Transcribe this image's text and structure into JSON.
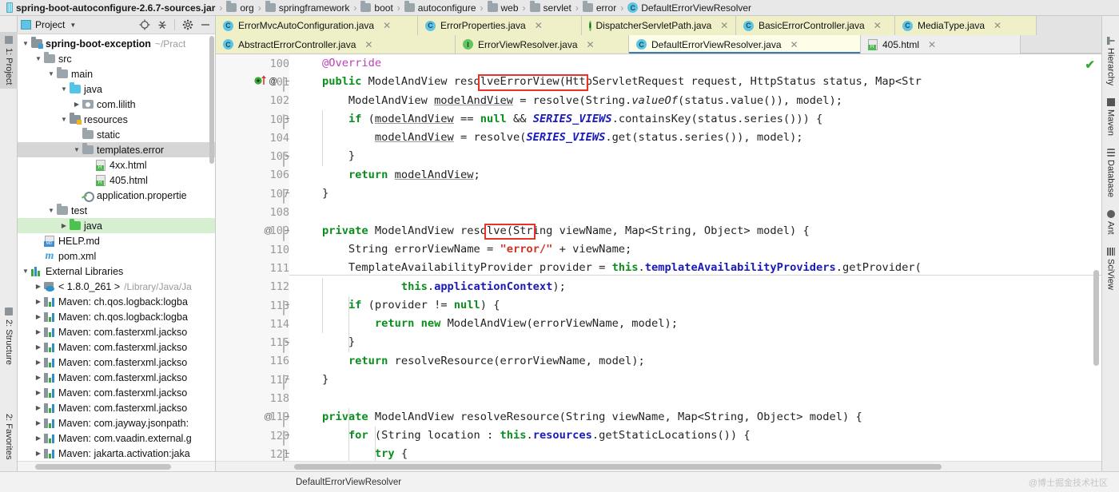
{
  "breadcrumb": [
    {
      "icon": "jar-icon",
      "label": "spring-boot-autoconfigure-2.6.7-sources.jar",
      "type": "jar"
    },
    {
      "icon": "folder-icon",
      "label": "org",
      "type": "folder"
    },
    {
      "icon": "folder-icon",
      "label": "springframework",
      "type": "folder"
    },
    {
      "icon": "folder-icon",
      "label": "boot",
      "type": "folder"
    },
    {
      "icon": "folder-icon",
      "label": "autoconfigure",
      "type": "folder"
    },
    {
      "icon": "folder-icon",
      "label": "web",
      "type": "folder"
    },
    {
      "icon": "folder-icon",
      "label": "servlet",
      "type": "folder"
    },
    {
      "icon": "folder-icon",
      "label": "error",
      "type": "folder"
    },
    {
      "icon": "class-icon",
      "label": "DefaultErrorViewResolver",
      "type": "class"
    }
  ],
  "left_strip": {
    "tabs": [
      {
        "label": "1: Project",
        "selected": true
      },
      {
        "label": "2: Structure",
        "selected": false
      },
      {
        "label": "2: Favorites",
        "selected": false
      }
    ]
  },
  "project_panel": {
    "title": "Project",
    "toolbar_icons": [
      "locate-icon",
      "collapse-all-icon",
      "gear-icon",
      "minimize-icon"
    ],
    "tree": [
      {
        "indent": 0,
        "arrow": "open",
        "icon": "module-folder-icon",
        "label": "spring-boot-exception",
        "bold": true,
        "sub": "~/Pract",
        "state": "normal"
      },
      {
        "indent": 1,
        "arrow": "open",
        "icon": "folder-gray-icon",
        "label": "src",
        "bold": false,
        "sub": "",
        "state": "normal"
      },
      {
        "indent": 2,
        "arrow": "open",
        "icon": "folder-gray-icon",
        "label": "main",
        "bold": false,
        "sub": "",
        "state": "normal"
      },
      {
        "indent": 3,
        "arrow": "open",
        "icon": "folder-blue-icon",
        "label": "java",
        "bold": false,
        "sub": "",
        "state": "normal"
      },
      {
        "indent": 4,
        "arrow": "closed",
        "icon": "package-icon",
        "label": "com.lilith",
        "bold": false,
        "sub": "",
        "state": "normal"
      },
      {
        "indent": 3,
        "arrow": "open",
        "icon": "resources-folder-icon",
        "label": "resources",
        "bold": false,
        "sub": "",
        "state": "normal"
      },
      {
        "indent": 4,
        "arrow": "none",
        "icon": "folder-gray-icon",
        "label": "static",
        "bold": false,
        "sub": "",
        "state": "normal"
      },
      {
        "indent": 4,
        "arrow": "open",
        "icon": "folder-gray-icon",
        "label": "templates.error",
        "bold": false,
        "sub": "",
        "state": "selected"
      },
      {
        "indent": 5,
        "arrow": "none",
        "icon": "html-file-icon",
        "label": "4xx.html",
        "bold": false,
        "sub": "",
        "state": "normal"
      },
      {
        "indent": 5,
        "arrow": "none",
        "icon": "html-file-icon",
        "label": "405.html",
        "bold": false,
        "sub": "",
        "state": "normal"
      },
      {
        "indent": 4,
        "arrow": "none",
        "icon": "properties-file-icon",
        "label": "application.propertie",
        "bold": false,
        "sub": "",
        "state": "normal"
      },
      {
        "indent": 2,
        "arrow": "open",
        "icon": "folder-gray-icon",
        "label": "test",
        "bold": false,
        "sub": "",
        "state": "normal"
      },
      {
        "indent": 3,
        "arrow": "closed",
        "icon": "folder-green-icon",
        "label": "java",
        "bold": false,
        "sub": "",
        "state": "greensel"
      },
      {
        "indent": 1,
        "arrow": "none",
        "icon": "markdown-file-icon",
        "label": "HELP.md",
        "bold": false,
        "sub": "",
        "state": "normal"
      },
      {
        "indent": 1,
        "arrow": "none",
        "icon": "maven-xml-icon",
        "label": "pom.xml",
        "bold": false,
        "sub": "",
        "state": "normal"
      },
      {
        "indent": 0,
        "arrow": "open",
        "icon": "external-libraries-icon",
        "label": "External Libraries",
        "bold": false,
        "sub": "",
        "state": "normal"
      },
      {
        "indent": 1,
        "arrow": "closed",
        "icon": "jdk-icon",
        "label": "< 1.8.0_261 >",
        "bold": false,
        "sub": "/Library/Java/Ja",
        "state": "normal"
      },
      {
        "indent": 1,
        "arrow": "closed",
        "icon": "maven-lib-icon",
        "label": "Maven: ch.qos.logback:logba",
        "bold": false,
        "sub": "",
        "state": "normal"
      },
      {
        "indent": 1,
        "arrow": "closed",
        "icon": "maven-lib-icon",
        "label": "Maven: ch.qos.logback:logba",
        "bold": false,
        "sub": "",
        "state": "normal"
      },
      {
        "indent": 1,
        "arrow": "closed",
        "icon": "maven-lib-icon",
        "label": "Maven: com.fasterxml.jackso",
        "bold": false,
        "sub": "",
        "state": "normal"
      },
      {
        "indent": 1,
        "arrow": "closed",
        "icon": "maven-lib-icon",
        "label": "Maven: com.fasterxml.jackso",
        "bold": false,
        "sub": "",
        "state": "normal"
      },
      {
        "indent": 1,
        "arrow": "closed",
        "icon": "maven-lib-icon",
        "label": "Maven: com.fasterxml.jackso",
        "bold": false,
        "sub": "",
        "state": "normal"
      },
      {
        "indent": 1,
        "arrow": "closed",
        "icon": "maven-lib-icon",
        "label": "Maven: com.fasterxml.jackso",
        "bold": false,
        "sub": "",
        "state": "normal"
      },
      {
        "indent": 1,
        "arrow": "closed",
        "icon": "maven-lib-icon",
        "label": "Maven: com.fasterxml.jackso",
        "bold": false,
        "sub": "",
        "state": "normal"
      },
      {
        "indent": 1,
        "arrow": "closed",
        "icon": "maven-lib-icon",
        "label": "Maven: com.fasterxml.jackso",
        "bold": false,
        "sub": "",
        "state": "normal"
      },
      {
        "indent": 1,
        "arrow": "closed",
        "icon": "maven-lib-icon",
        "label": "Maven: com.jayway.jsonpath:",
        "bold": false,
        "sub": "",
        "state": "normal"
      },
      {
        "indent": 1,
        "arrow": "closed",
        "icon": "maven-lib-icon",
        "label": "Maven: com.vaadin.external.g",
        "bold": false,
        "sub": "",
        "state": "normal"
      },
      {
        "indent": 1,
        "arrow": "closed",
        "icon": "maven-lib-icon",
        "label": "Maven: jakarta.activation:jaka",
        "bold": false,
        "sub": "",
        "state": "normal"
      }
    ]
  },
  "editor_tabs_row1": [
    {
      "label": "ErrorMvcAutoConfiguration.java",
      "icon": "class-icon",
      "closable": true,
      "active": false
    },
    {
      "label": "ErrorProperties.java",
      "icon": "class-icon",
      "closable": true,
      "active": false
    },
    {
      "label": "DispatcherServletPath.java",
      "icon": "interface-icon",
      "closable": true,
      "active": false
    },
    {
      "label": "BasicErrorController.java",
      "icon": "class-icon",
      "closable": true,
      "active": false
    },
    {
      "label": "MediaType.java",
      "icon": "class-icon",
      "closable": true,
      "active": false
    }
  ],
  "editor_tabs_row2": [
    {
      "label": "AbstractErrorController.java",
      "icon": "class-icon",
      "closable": true,
      "active": false
    },
    {
      "label": "ErrorViewResolver.java",
      "icon": "interface-icon",
      "closable": true,
      "active": false
    },
    {
      "label": "DefaultErrorViewResolver.java",
      "icon": "class-icon",
      "closable": true,
      "active": true
    },
    {
      "label": "405.html",
      "icon": "html-file-icon",
      "closable": true,
      "active": false
    }
  ],
  "editor": {
    "inspection_ok_icon": "green-check-icon",
    "lines": [
      {
        "num": "100",
        "gutter": "",
        "fold": false,
        "tokens": [
          {
            "t": "    ",
            "c": ""
          },
          {
            "t": "@Override",
            "c": "ann"
          }
        ]
      },
      {
        "num": "101",
        "gutter": "impl-override-icon",
        "fold": true,
        "tokens": [
          {
            "t": "    ",
            "c": ""
          },
          {
            "t": "public",
            "c": "kw"
          },
          {
            "t": " ModelAndView resolveErrorView(HttpServletRequest request, HttpStatus status, Map<Str",
            "c": ""
          }
        ]
      },
      {
        "num": "102",
        "gutter": "",
        "fold": false,
        "tokens": [
          {
            "t": "        ModelAndView ",
            "c": ""
          },
          {
            "t": "modelAndView",
            "c": "und"
          },
          {
            "t": " = resolve(String.",
            "c": ""
          },
          {
            "t": "valueOf",
            "c": "it"
          },
          {
            "t": "(status.value()), model);",
            "c": ""
          }
        ]
      },
      {
        "num": "103",
        "gutter": "",
        "fold": true,
        "tokens": [
          {
            "t": "        ",
            "c": ""
          },
          {
            "t": "if",
            "c": "kw"
          },
          {
            "t": " (",
            "c": ""
          },
          {
            "t": "modelAndView",
            "c": "und"
          },
          {
            "t": " == ",
            "c": ""
          },
          {
            "t": "null",
            "c": "kw"
          },
          {
            "t": " && ",
            "c": ""
          },
          {
            "t": "SERIES_VIEWS",
            "c": "cst"
          },
          {
            "t": ".containsKey(status.series())) {",
            "c": ""
          }
        ]
      },
      {
        "num": "104",
        "gutter": "",
        "fold": false,
        "tokens": [
          {
            "t": "            ",
            "c": ""
          },
          {
            "t": "modelAndView",
            "c": "und"
          },
          {
            "t": " = resolve(",
            "c": ""
          },
          {
            "t": "SERIES_VIEWS",
            "c": "cst"
          },
          {
            "t": ".get(status.series()), model);",
            "c": ""
          }
        ]
      },
      {
        "num": "105",
        "gutter": "",
        "fold": true,
        "tokens": [
          {
            "t": "        }",
            "c": ""
          }
        ]
      },
      {
        "num": "106",
        "gutter": "",
        "fold": false,
        "tokens": [
          {
            "t": "        ",
            "c": ""
          },
          {
            "t": "return",
            "c": "kw"
          },
          {
            "t": " ",
            "c": ""
          },
          {
            "t": "modelAndView",
            "c": "und"
          },
          {
            "t": ";",
            "c": ""
          }
        ]
      },
      {
        "num": "107",
        "gutter": "",
        "fold": true,
        "tokens": [
          {
            "t": "    }",
            "c": ""
          }
        ]
      },
      {
        "num": "108",
        "gutter": "",
        "fold": false,
        "tokens": [
          {
            "t": "",
            "c": ""
          }
        ]
      },
      {
        "num": "109",
        "gutter": "@",
        "fold": true,
        "tokens": [
          {
            "t": "    ",
            "c": ""
          },
          {
            "t": "private",
            "c": "kw"
          },
          {
            "t": " ModelAndView resolve(String viewName, Map<String, Object> model) {",
            "c": ""
          }
        ]
      },
      {
        "num": "110",
        "gutter": "",
        "fold": false,
        "tokens": [
          {
            "t": "        String errorViewName = ",
            "c": ""
          },
          {
            "t": "\"error/\"",
            "c": "str"
          },
          {
            "t": " + viewName;",
            "c": ""
          }
        ]
      },
      {
        "num": "111",
        "gutter": "",
        "fold": false,
        "tokens": [
          {
            "t": "        TemplateAvailabilityProvider provider = ",
            "c": ""
          },
          {
            "t": "this",
            "c": "kw"
          },
          {
            "t": ".",
            "c": ""
          },
          {
            "t": "templateAvailabilityProviders",
            "c": "fld"
          },
          {
            "t": ".getProvider(",
            "c": ""
          }
        ]
      },
      {
        "num": "112",
        "gutter": "",
        "fold": false,
        "tokens": [
          {
            "t": "                ",
            "c": ""
          },
          {
            "t": "this",
            "c": "kw"
          },
          {
            "t": ".",
            "c": ""
          },
          {
            "t": "applicationContext",
            "c": "fld"
          },
          {
            "t": ");",
            "c": ""
          }
        ]
      },
      {
        "num": "113",
        "gutter": "",
        "fold": true,
        "tokens": [
          {
            "t": "        ",
            "c": ""
          },
          {
            "t": "if",
            "c": "kw"
          },
          {
            "t": " (provider != ",
            "c": ""
          },
          {
            "t": "null",
            "c": "kw"
          },
          {
            "t": ") {",
            "c": ""
          }
        ]
      },
      {
        "num": "114",
        "gutter": "",
        "fold": false,
        "tokens": [
          {
            "t": "            ",
            "c": ""
          },
          {
            "t": "return",
            "c": "kw"
          },
          {
            "t": " ",
            "c": ""
          },
          {
            "t": "new",
            "c": "kw"
          },
          {
            "t": " ModelAndView(errorViewName, model);",
            "c": ""
          }
        ]
      },
      {
        "num": "115",
        "gutter": "",
        "fold": true,
        "tokens": [
          {
            "t": "        }",
            "c": ""
          }
        ]
      },
      {
        "num": "116",
        "gutter": "",
        "fold": false,
        "tokens": [
          {
            "t": "        ",
            "c": ""
          },
          {
            "t": "return",
            "c": "kw"
          },
          {
            "t": " resolveResource(errorViewName, model);",
            "c": ""
          }
        ]
      },
      {
        "num": "117",
        "gutter": "",
        "fold": true,
        "tokens": [
          {
            "t": "    }",
            "c": ""
          }
        ]
      },
      {
        "num": "118",
        "gutter": "",
        "fold": false,
        "tokens": [
          {
            "t": "",
            "c": ""
          }
        ]
      },
      {
        "num": "119",
        "gutter": "@",
        "fold": true,
        "tokens": [
          {
            "t": "    ",
            "c": ""
          },
          {
            "t": "private",
            "c": "kw"
          },
          {
            "t": " ModelAndView resolveResource(String viewName, Map<String, Object> model) {",
            "c": ""
          }
        ]
      },
      {
        "num": "120",
        "gutter": "",
        "fold": true,
        "tokens": [
          {
            "t": "        ",
            "c": ""
          },
          {
            "t": "for",
            "c": "kw"
          },
          {
            "t": " (String location : ",
            "c": ""
          },
          {
            "t": "this",
            "c": "kw"
          },
          {
            "t": ".",
            "c": ""
          },
          {
            "t": "resources",
            "c": "fld"
          },
          {
            "t": ".getStaticLocations()) {",
            "c": ""
          }
        ]
      },
      {
        "num": "121",
        "gutter": "",
        "fold": true,
        "tokens": [
          {
            "t": "            ",
            "c": ""
          },
          {
            "t": "try",
            "c": "kw"
          },
          {
            "t": " {",
            "c": ""
          }
        ]
      }
    ],
    "highlights": [
      {
        "label": "resolveErrorView",
        "line": 101
      },
      {
        "label": "resolve",
        "line": 109
      }
    ]
  },
  "right_strip": {
    "tabs": [
      {
        "label": "Hierarchy",
        "icon": "hierarchy-icon"
      },
      {
        "label": "Maven",
        "icon": "maven-icon"
      },
      {
        "label": "Database",
        "icon": "database-icon"
      },
      {
        "label": "Ant",
        "icon": "ant-icon"
      },
      {
        "label": "SciView",
        "icon": "sciview-icon"
      }
    ]
  },
  "status_bar": {
    "text": "DefaultErrorViewResolver",
    "watermark": "@博士掘金技术社区"
  },
  "colors": {
    "tab_active": "#fbfbe0",
    "tab_inactive": "#eff0c8",
    "highlight_border": "#e8322a",
    "keyword": "#0a8f1e",
    "string": "#cc3322",
    "constant": "#1a1ab8",
    "annotation": "#bb3fbb",
    "selection": "#d6d6d6",
    "green_selection": "#d5efd0"
  }
}
